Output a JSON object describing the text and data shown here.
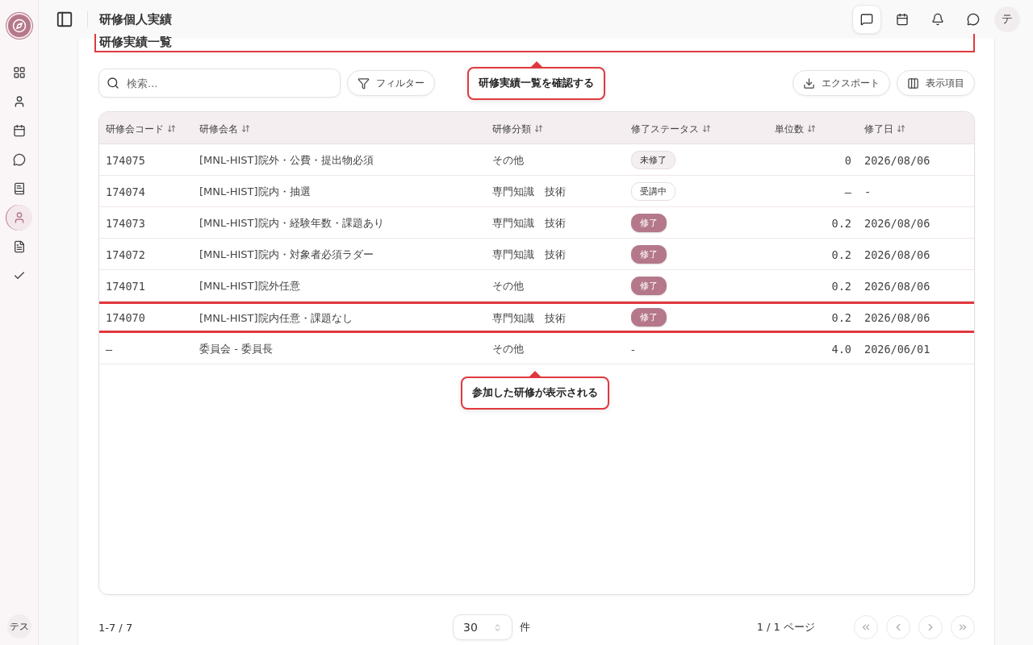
{
  "sidebar": {
    "items": [
      {
        "selected": false
      },
      {
        "selected": false
      },
      {
        "selected": false
      },
      {
        "selected": false
      },
      {
        "selected": false
      },
      {
        "selected": true
      },
      {
        "selected": false
      },
      {
        "selected": false
      }
    ],
    "user_initials": "テス"
  },
  "header": {
    "title": "研修個人実績",
    "actions": [
      {
        "selected": true
      },
      {
        "selected": false
      },
      {
        "selected": false
      },
      {
        "selected": false
      }
    ],
    "avatar": "テ"
  },
  "section": {
    "title": "研修実績一覧",
    "highlighted": true,
    "callout": "研修実績一覧を確認する"
  },
  "toolbar": {
    "search": {
      "placeholder": "検索..."
    },
    "filter_button": "フィルター",
    "export_button": "エクスポート",
    "columns_button": "表示項目"
  },
  "table": {
    "columns": [
      "研修会コード",
      "研修会名",
      "研修分類",
      "修了ステータス",
      "単位数",
      "修了日"
    ],
    "rows": [
      {
        "code": "174075",
        "name": "[MNL-HIST]院外・公費・提出物必須",
        "category": "その他",
        "status": {
          "label": "未修了",
          "kind": "pending"
        },
        "units": "0",
        "date": "2026/08/06",
        "highlighted": false
      },
      {
        "code": "174074",
        "name": "[MNL-HIST]院内・抽選",
        "category": "専門知識　技術",
        "status": {
          "label": "受講中",
          "kind": "in_progress"
        },
        "units": "–",
        "date": "-",
        "highlighted": false
      },
      {
        "code": "174073",
        "name": "[MNL-HIST]院内・経験年数・課題あり",
        "category": "専門知識　技術",
        "status": {
          "label": "修了",
          "kind": "done"
        },
        "units": "0.2",
        "date": "2026/08/06",
        "highlighted": false
      },
      {
        "code": "174072",
        "name": "[MNL-HIST]院内・対象者必須ラダー",
        "category": "専門知識　技術",
        "status": {
          "label": "修了",
          "kind": "done"
        },
        "units": "0.2",
        "date": "2026/08/06",
        "highlighted": false
      },
      {
        "code": "174071",
        "name": "[MNL-HIST]院外任意",
        "category": "その他",
        "status": {
          "label": "修了",
          "kind": "done"
        },
        "units": "0.2",
        "date": "2026/08/06",
        "highlighted": false
      },
      {
        "code": "174070",
        "name": "[MNL-HIST]院内任意・課題なし",
        "category": "専門知識　技術",
        "status": {
          "label": "修了",
          "kind": "done"
        },
        "units": "0.2",
        "date": "2026/08/06",
        "highlighted": true
      },
      {
        "code": "–",
        "name": "委員会 - 委員長",
        "category": "その他",
        "status": {
          "label": "-",
          "kind": "none"
        },
        "units": "4.0",
        "date": "2026/06/01",
        "highlighted": false
      }
    ],
    "callout": "参加した研修が表示される"
  },
  "pagination": {
    "range": "1-7 / 7",
    "page_size": "30",
    "page_size_unit": "件",
    "page": "1 / 1 ページ",
    "buttons": [
      {
        "disabled": true
      },
      {
        "disabled": true
      },
      {
        "disabled": true
      },
      {
        "disabled": true
      }
    ]
  }
}
